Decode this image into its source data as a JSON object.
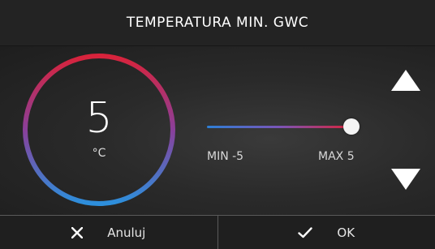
{
  "header": {
    "title": "TEMPERATURA MIN. GWC"
  },
  "dial": {
    "value": "5",
    "unit": "°C"
  },
  "slider": {
    "min_label": "MIN -5",
    "max_label": "MAX 5",
    "min": -5,
    "max": 5,
    "value": 5
  },
  "icons": {
    "up": "triangle-up-icon",
    "down": "triangle-down-icon",
    "cancel": "x-icon",
    "ok": "check-icon"
  },
  "colors": {
    "gradient_hot": "#d8233b",
    "gradient_cold": "#2d7fd6",
    "accent_mid": "#7a55b8"
  },
  "footer": {
    "cancel_label": "Anuluj",
    "ok_label": "OK"
  }
}
